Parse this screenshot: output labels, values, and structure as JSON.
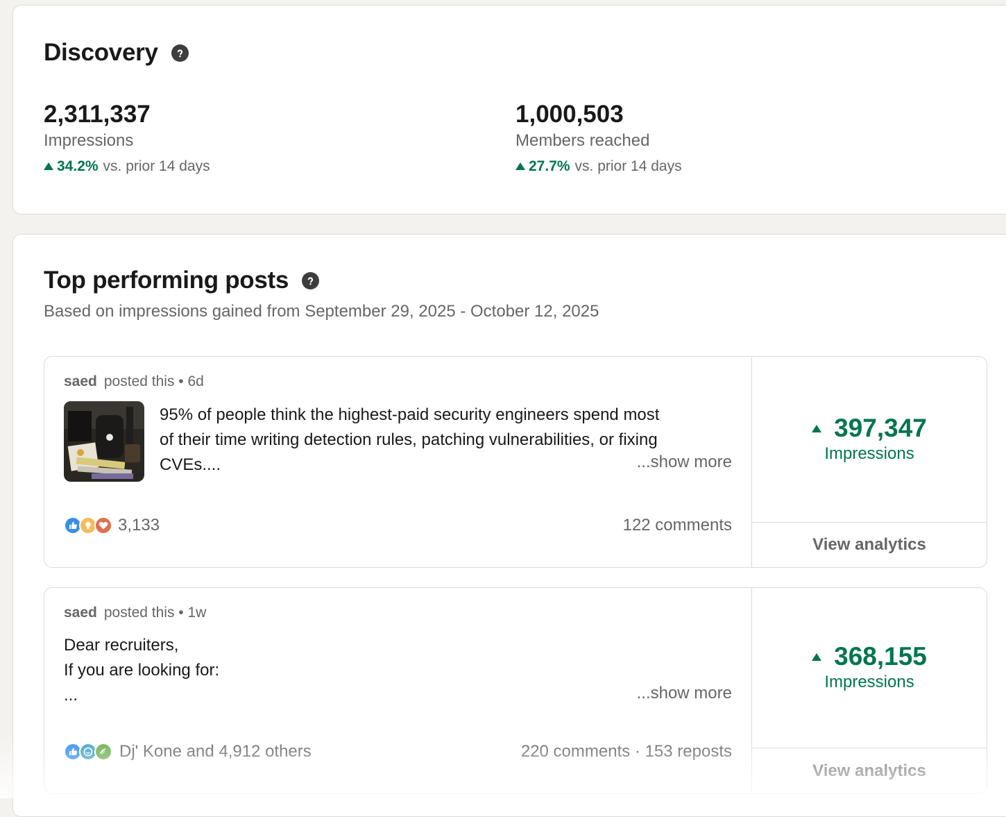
{
  "discovery": {
    "title": "Discovery",
    "metrics": [
      {
        "value": "2,311,337",
        "label": "Impressions",
        "change": "34.2%",
        "change_suffix": "vs. prior 14 days"
      },
      {
        "value": "1,000,503",
        "label": "Members reached",
        "change": "27.7%",
        "change_suffix": "vs. prior 14 days"
      }
    ]
  },
  "top_posts": {
    "title": "Top performing posts",
    "subtitle": "Based on impressions gained from September 29, 2025 - October 12, 2025",
    "posts": [
      {
        "author": "saed",
        "meta": "posted this • 6d",
        "text_lines": [
          "95% of people think the highest-paid security engineers spend most",
          "of their time writing detection rules, patching vulnerabilities, or fixing",
          "CVEs...."
        ],
        "show_more": "...show more",
        "reactions_count": "3,133",
        "reaction_icons": [
          "like-icon",
          "insightful-icon",
          "love-icon"
        ],
        "counts": "122 comments",
        "impressions": "397,347",
        "impressions_label": "Impressions",
        "view_analytics": "View analytics"
      },
      {
        "author": "saed",
        "meta": "posted this • 1w",
        "text_lines": [
          "Dear recruiters,",
          "If you are looking for:",
          "..."
        ],
        "show_more": "...show more",
        "reactions_count": "Dj' Kone and 4,912 others",
        "reaction_icons": [
          "like-icon",
          "funny-icon",
          "support-icon"
        ],
        "counts": "220 comments · 153 reposts",
        "impressions": "368,155",
        "impressions_label": "Impressions",
        "view_analytics": "View analytics"
      }
    ]
  },
  "colors": {
    "accent_green": "#01754f",
    "muted_text": "#666666",
    "background": "#f4f2ee"
  }
}
